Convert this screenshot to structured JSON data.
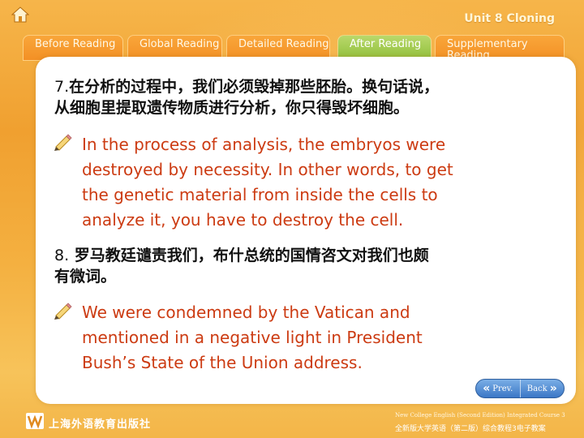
{
  "header": {
    "home_icon": "home-icon",
    "unit_title": "Unit 8 Cloning"
  },
  "tabs": [
    {
      "label": "Before Reading",
      "active": false
    },
    {
      "label": "Global Reading",
      "active": false
    },
    {
      "label": "Detailed Reading",
      "active": false
    },
    {
      "label": "After Reading",
      "active": true
    },
    {
      "label": "Supplementary Reading",
      "active": false
    }
  ],
  "items": [
    {
      "number": "7.",
      "chinese": [
        "在分析的过程中，我们必须毁掉那些胚胎。换句话说，",
        "从细胞里提取遗传物质进行分析，你只得毁坏细胞。"
      ],
      "english": [
        "In the process of analysis, the embryos were",
        "destroyed by necessity. In other words, to get",
        "the genetic material from inside the cells to",
        "analyze it, you have to destroy the cell."
      ]
    },
    {
      "number": "8.",
      "chinese": [
        "罗马教廷谴责我们，布什总统的国情咨文对我们也颇",
        "有微词。"
      ],
      "english": [
        "We were condemned by the Vatican and",
        "mentioned in a negative light in President",
        "Bush’s State of the Union address."
      ]
    }
  ],
  "navigation": {
    "prev_label": "Prev.",
    "back_label": "Back"
  },
  "footer": {
    "publisher": "上海外语教育出版社",
    "course_en": "New College English (Second Edition) Integrated Course 3",
    "course_cn": "全新版大学英语（第二版）综合教程3电子教案"
  },
  "colors": {
    "background": "#f0a030",
    "english_text": "#cc3b12",
    "active_tab": "#8fbf3a",
    "nav_button": "#3b77c6"
  }
}
